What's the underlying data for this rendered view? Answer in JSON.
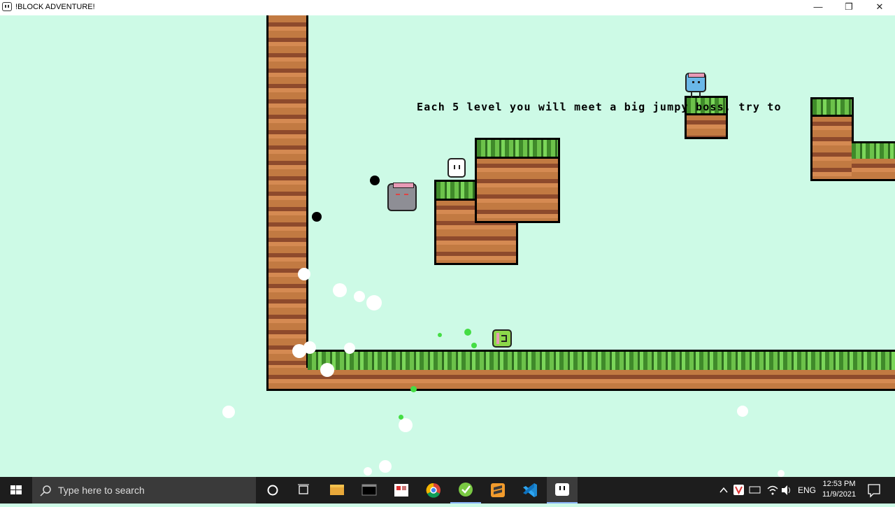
{
  "window": {
    "title": "!BLOCK ADVENTURE!",
    "minimize": "—",
    "restore": "❐",
    "close": "✕"
  },
  "game": {
    "tutorial_text": "Each 5 level you will meet a big jumpy boss, try to"
  },
  "taskbar": {
    "search_placeholder": "Type here to search",
    "language": "ENG",
    "time": "12:53 PM",
    "date": "11/9/2021",
    "apps": [
      "cortana-icon",
      "task-view-icon",
      "file-explorer-icon",
      "terminal-icon",
      "paint-icon",
      "chrome-icon",
      "app-green-icon",
      "sublime-text-icon",
      "vscode-icon",
      "block-adventure-icon"
    ]
  },
  "colors": {
    "background": "#cdfae6",
    "dirt_light": "#c27a42",
    "dirt_dark": "#8e4a2c",
    "grass": "#6cc24a",
    "taskbar": "#1d1d1d"
  }
}
